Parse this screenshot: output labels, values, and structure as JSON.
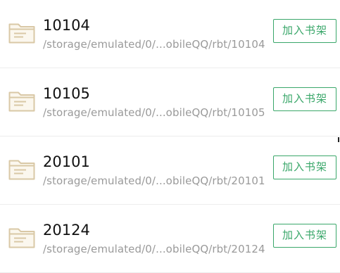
{
  "file_list": {
    "rows": [
      {
        "name": "10104",
        "path": "/storage/emulated/0/...obileQQ/rbt/10104",
        "button_label": "加入书架"
      },
      {
        "name": "10105",
        "path": "/storage/emulated/0/...obileQQ/rbt/10105",
        "button_label": "加入书架"
      },
      {
        "name": "20101",
        "path": "/storage/emulated/0/...obileQQ/rbt/20101",
        "button_label": "加入书架"
      },
      {
        "name": "20124",
        "path": "/storage/emulated/0/...obileQQ/rbt/20124",
        "button_label": "加入书架"
      }
    ],
    "folder_icon": "folder-icon"
  },
  "colors": {
    "accent": "#3aa76a",
    "folder": "#d9c8a6",
    "primary_text": "#111111",
    "secondary_text": "#9a9a9a",
    "divider": "#ededed"
  }
}
